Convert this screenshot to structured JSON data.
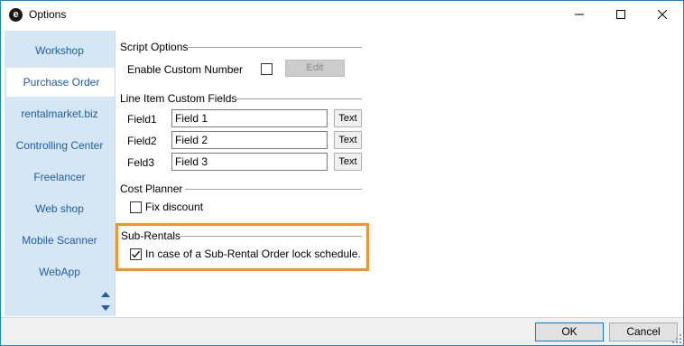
{
  "window": {
    "title": "Options",
    "app_icon_glyph": "e",
    "controls": {
      "minimize_icon": "minimize-icon",
      "maximize_icon": "maximize-icon",
      "close_icon": "close-icon"
    }
  },
  "sidebar": {
    "items": [
      {
        "label": "Workshop",
        "active": false
      },
      {
        "label": "Purchase Order",
        "active": true
      },
      {
        "label": "rentalmarket.biz",
        "active": false
      },
      {
        "label": "Controlling Center",
        "active": false
      },
      {
        "label": "Freelancer",
        "active": false
      },
      {
        "label": "Web shop",
        "active": false
      },
      {
        "label": "Mobile Scanner",
        "active": false
      },
      {
        "label": "WebApp",
        "active": false
      }
    ],
    "scroll_up_icon": "triangle-up-icon",
    "scroll_down_icon": "triangle-down-icon"
  },
  "script_options": {
    "title": "Script Options",
    "enable_custom_number_label": "Enable Custom Number",
    "enable_custom_number_checked": false,
    "edit_button_label": "Edit"
  },
  "line_item_custom_fields": {
    "title": "Line Item Custom Fields",
    "rows": [
      {
        "label": "Field1",
        "value": "Field 1",
        "type_label": "Text"
      },
      {
        "label": "Field2",
        "value": "Field 2",
        "type_label": "Text"
      },
      {
        "label": "Feld3",
        "value": "Field 3",
        "type_label": "Text"
      }
    ]
  },
  "cost_planner": {
    "title": "Cost Planner",
    "fix_discount_label": "Fix discount",
    "fix_discount_checked": false
  },
  "sub_rentals": {
    "title": "Sub-Rentals",
    "lock_schedule_label": "In case of a Sub-Rental Order lock schedule.",
    "lock_schedule_checked": true,
    "highlight_color": "#f4922b"
  },
  "footer": {
    "ok_label": "OK",
    "cancel_label": "Cancel"
  },
  "colors": {
    "sidebar_bg": "#d5e6f5",
    "sidebar_text": "#1f5ea8",
    "window_border": "#1883d7"
  }
}
